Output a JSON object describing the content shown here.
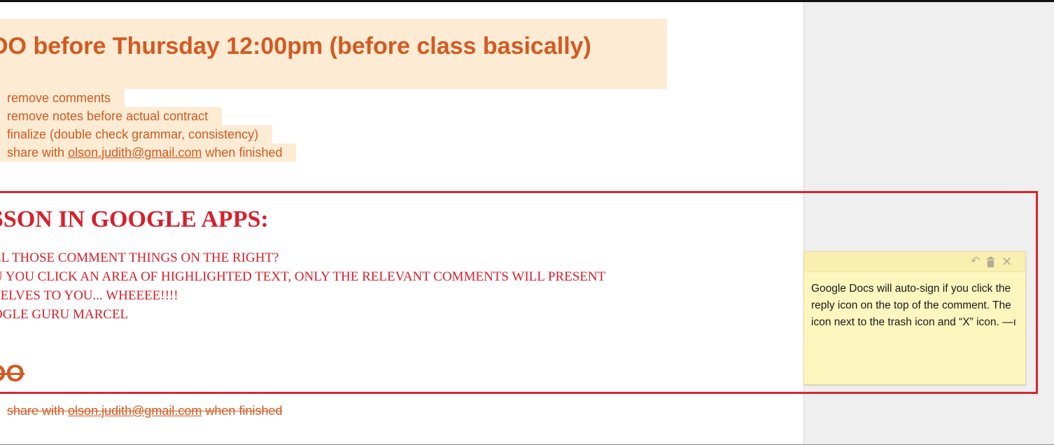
{
  "todo": {
    "heading": "DO before Thursday 12:00pm (before class basically)",
    "items": [
      {
        "text": "remove comments"
      },
      {
        "text": "remove notes before actual contract"
      },
      {
        "text": "finalize (double check grammar, consistency)"
      },
      {
        "prefix": "share with ",
        "email": "olson.judith@gmail.com",
        "suffix": " when finished"
      }
    ]
  },
  "lesson": {
    "heading": "SSON IN GOOGLE APPS:",
    "lines": [
      "LL THOSE COMMENT THINGS ON THE RIGHT?",
      "U YOU CLICK AN AREA OF HIGHLIGHTED TEXT, ONLY THE RELEVANT COMMENTS WILL PRESENT",
      "SELVES TO YOU... WHEEEE!!!!",
      "OGLE GURU MARCEL"
    ]
  },
  "done": {
    "heading": "DO",
    "item_prefix": "share with ",
    "item_email": "olson.judith@gmail.com",
    "item_suffix": " when finished"
  },
  "comment": {
    "text": "Google Docs will auto-sign if you click the reply icon on the top of the comment. The icon next to the trash icon and “X” icon.  —ı",
    "icons": [
      "reply-icon",
      "trash-icon",
      "close-icon"
    ]
  },
  "colors": {
    "orange_text": "#d25a22",
    "red_text": "#d6202c",
    "highlight": "#fdebd3",
    "comment_bg": "#fdf7bf",
    "annotation_box": "#d8252f"
  }
}
